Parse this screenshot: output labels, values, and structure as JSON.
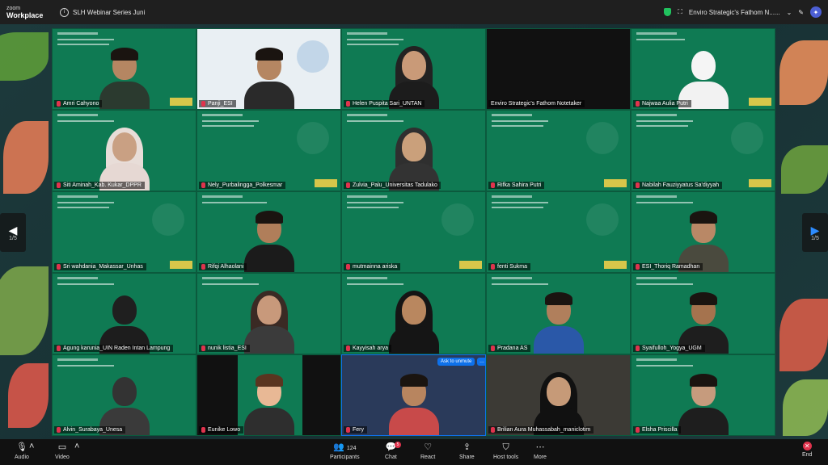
{
  "app": {
    "brand_line1": "zoom",
    "brand_line2": "Workplace",
    "meeting_title": "SLH Webinar Series Juni"
  },
  "topbar": {
    "recording_label": "Enviro Strategic's Fathom N......"
  },
  "pager": {
    "left": "1/5",
    "right": "1/5"
  },
  "tiles": [
    {
      "name": "Amri Cahyono",
      "type": "slide-person"
    },
    {
      "name": "Panji_ESI",
      "type": "slide-person"
    },
    {
      "name": "Helen Puspita Sari_UNTAN",
      "type": "slide-person"
    },
    {
      "name": "Enviro Strategic's Fathom Notetaker",
      "type": "dark"
    },
    {
      "name": "Najwaa Aulia Putri",
      "type": "slide-avatar"
    },
    {
      "name": "Siti Aminah_Kab. Kukar_DPPR",
      "type": "slide-person"
    },
    {
      "name": "Nely_Purbalingga_Polkesmar",
      "type": "slide"
    },
    {
      "name": "Zulvia_Palu_Universitas Tadulako",
      "type": "slide-person"
    },
    {
      "name": "Rifka Sahira Putri",
      "type": "slide"
    },
    {
      "name": "Nabilah Fauziyyatus Sa'diyyah",
      "type": "slide"
    },
    {
      "name": "Sri wahdania_Makassar_Unhas",
      "type": "slide"
    },
    {
      "name": "Rifqi Alhaolani",
      "type": "slide-person"
    },
    {
      "name": "mutmainna ariska",
      "type": "slide"
    },
    {
      "name": "fenti Sukma",
      "type": "slide"
    },
    {
      "name": "ESI_Thoriq Ramadhan",
      "type": "slide-person"
    },
    {
      "name": "Agung karunia_UIN Raden Intan Lampung",
      "type": "slide-person"
    },
    {
      "name": "nunik listia_ESI",
      "type": "slide-person"
    },
    {
      "name": "Kayyisah arya",
      "type": "slide-person"
    },
    {
      "name": "Pradana AS",
      "type": "slide-person"
    },
    {
      "name": "Syaifulloh_Yogya_UGM",
      "type": "slide-person"
    },
    {
      "name": "Alvin_Surabaya_Unesa",
      "type": "slide-person"
    },
    {
      "name": "Eunike Lowo",
      "type": "slide-avatar"
    },
    {
      "name": "Fery",
      "type": "room-person"
    },
    {
      "name": "Brilian Aura Muhassabah_maniclotim",
      "type": "bright-person"
    },
    {
      "name": "Elsha Priscilla",
      "type": "slide-person"
    }
  ],
  "ask_to_unmute": "Ask to unmute",
  "more_dots": "…",
  "toolbar": {
    "audio": "Audio",
    "video": "Video",
    "participants": "Participants",
    "participants_count": "124",
    "chat": "Chat",
    "chat_badge": "5",
    "react": "React",
    "share": "Share",
    "host_tools": "Host tools",
    "more": "More",
    "end": "End"
  },
  "colors": {
    "slide_green": "#0f7a53",
    "accent_blue": "#0e71eb",
    "end_red": "#e0334d"
  }
}
